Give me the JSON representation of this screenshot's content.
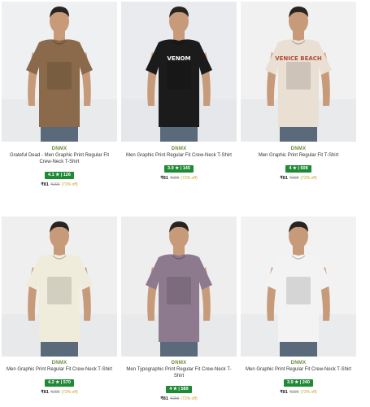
{
  "products": [
    {
      "brand": "DNMX",
      "title": "Grateful Dead - Men Graphic Print Regular Fit Crew-Neck T-Shirt",
      "rating": "4.1 ★ | 126",
      "price": "₹81",
      "mrp": "₹299",
      "discount": "(73% off)",
      "tee_color": "#8a6a4a",
      "print_text": "",
      "photo_bg": "#eef0f2"
    },
    {
      "brand": "DNMX",
      "title": "Men Graphic Print Regular Fit Crew-Neck T-Shirt",
      "rating": "3.9 ★ | 145",
      "price": "₹81",
      "mrp": "₹299",
      "discount": "(73% off)",
      "tee_color": "#1b1b1b",
      "print_text": "VENOM",
      "photo_bg": "#e9ebee"
    },
    {
      "brand": "DNMX",
      "title": "Men Graphic Print Regular Fit T-Shirt",
      "rating": "4 ★ | 608",
      "price": "₹81",
      "mrp": "₹299",
      "discount": "(73% off)",
      "tee_color": "#eadfd3",
      "print_text": "VENICE BEACH",
      "photo_bg": "#f1f1f1"
    },
    {
      "brand": "DNMX",
      "title": "Men Graphic Print Regular Fit Crew-Neck T-Shirt",
      "rating": "4.2 ★ | 570",
      "price": "₹81",
      "mrp": "₹299",
      "discount": "(73% off)",
      "tee_color": "#f0ecdc",
      "print_text": "",
      "photo_bg": "#efefef"
    },
    {
      "brand": "DNMX",
      "title": "Men Typographic Print Regular Fit Crew-Neck T-Shirt",
      "rating": "4 ★ | 589",
      "price": "₹81",
      "mrp": "₹299",
      "discount": "(73% off)",
      "tee_color": "#8d7a8f",
      "print_text": "",
      "photo_bg": "#eeeeee"
    },
    {
      "brand": "DNMX",
      "title": "Men Graphic Print Regular Fit Crew-Neck T-Shirt",
      "rating": "3.9 ★ | 240",
      "price": "₹81",
      "mrp": "₹299",
      "discount": "(73% off)",
      "tee_color": "#f3f3f3",
      "print_text": "",
      "photo_bg": "#f2f2f2"
    }
  ]
}
